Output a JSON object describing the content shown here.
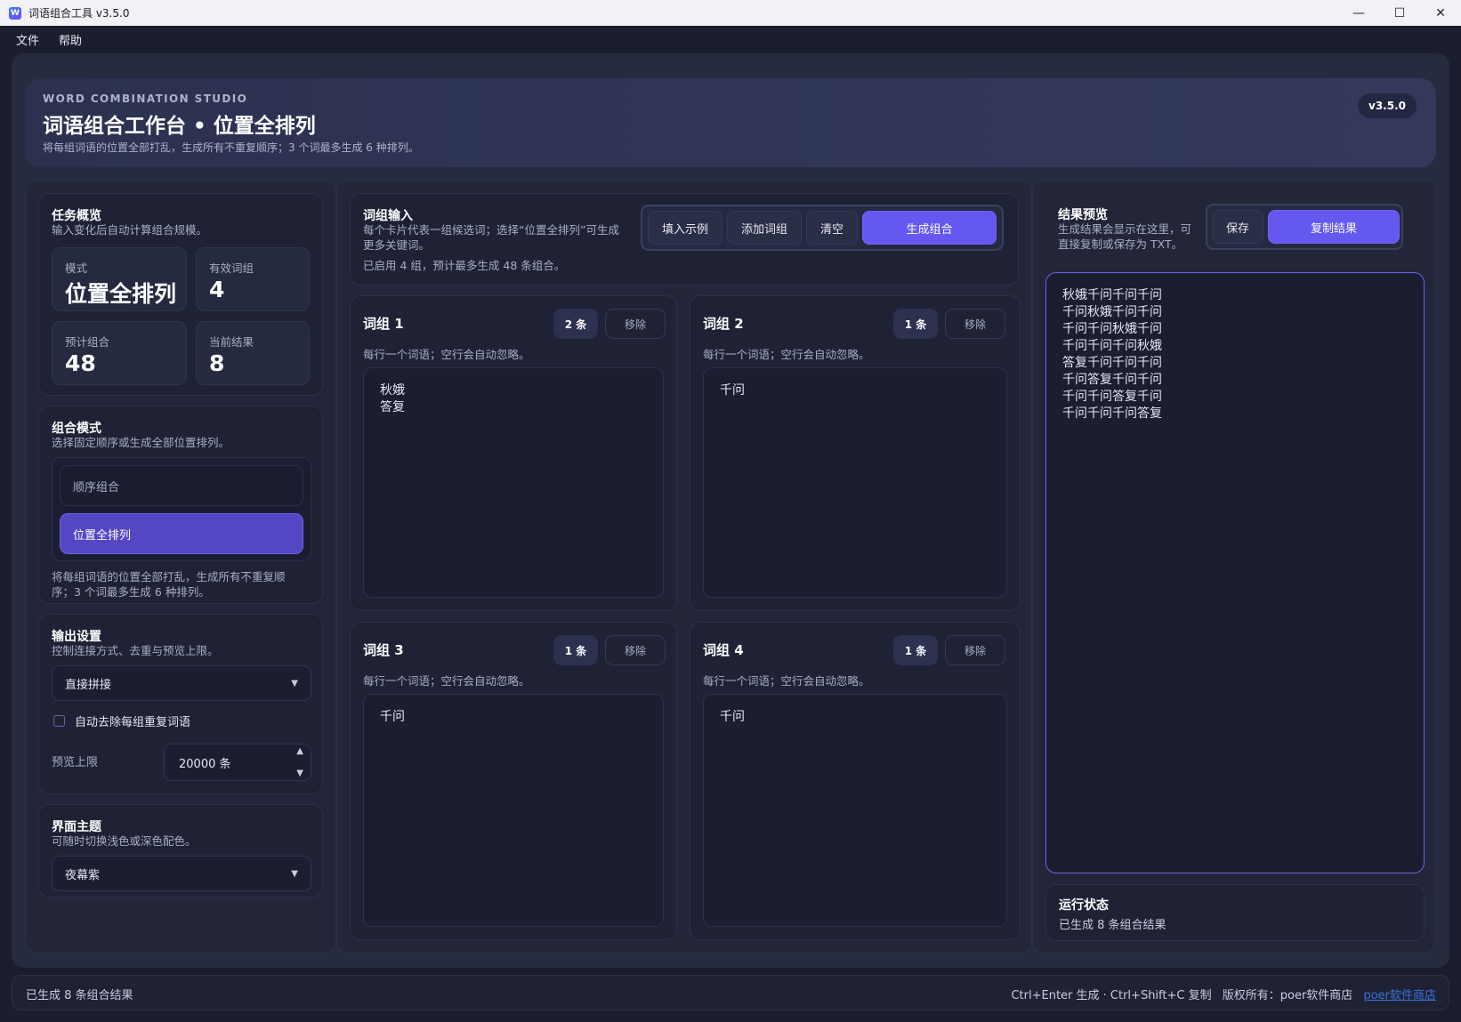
{
  "window": {
    "title": "词语组合工具 v3.5.0",
    "app_icon": "W",
    "controls": {
      "minimize": "—",
      "maximize": "☐",
      "close": "✕"
    }
  },
  "menu": [
    "文件",
    "帮助"
  ],
  "header": {
    "kicker": "WORD COMBINATION STUDIO",
    "title": "词语组合工作台 • 位置全排列",
    "subtitle": "将每组词语的位置全部打乱，生成所有不重复顺序；3 个词最多生成 6 种排列。",
    "version": "v3.5.0"
  },
  "overview": {
    "title": "任务概览",
    "subtitle": "输入变化后自动计算组合规模。",
    "stats": [
      {
        "label": "模式",
        "value": "位置全排列"
      },
      {
        "label": "有效词组",
        "value": "4"
      },
      {
        "label": "预计组合",
        "value": "48"
      },
      {
        "label": "当前结果",
        "value": "8"
      }
    ]
  },
  "mode": {
    "title": "组合模式",
    "subtitle": "选择固定顺序或生成全部位置排列。",
    "options": [
      "顺序组合",
      "位置全排列"
    ],
    "selected": "位置全排列",
    "description_lines": [
      "将每组词语的位置全部打乱，生成所有不重复顺",
      "序；3 个词最多生成 6 种排列。"
    ]
  },
  "output": {
    "title": "输出设置",
    "subtitle": "控制连接方式、去重与预览上限。",
    "join_mode": "直接拼接",
    "dedupe_label": "自动去除每组重复词语",
    "dedupe_checked": false,
    "preview_label": "预览上限",
    "preview_value": "20000 条"
  },
  "theme": {
    "title": "界面主题",
    "subtitle": "可随时切换浅色或深色配色。",
    "value": "夜幕紫"
  },
  "input": {
    "title": "词组输入",
    "subtitle_lines": [
      "每个卡片代表一组候选词；选择“位置全排列”可生成",
      "更多关键词。"
    ],
    "status": "已启用 4 组，预计最多生成 48 条组合。",
    "buttons": {
      "example": "填入示例",
      "add": "添加词组",
      "clear": "清空",
      "generate": "生成组合"
    }
  },
  "groups": [
    {
      "title": "词组 1",
      "count": "2 条",
      "remove": "移除",
      "hint": "每行一个词语；空行会自动忽略。",
      "text": "秋娥\n答复"
    },
    {
      "title": "词组 2",
      "count": "1 条",
      "remove": "移除",
      "hint": "每行一个词语；空行会自动忽略。",
      "text": "千问"
    },
    {
      "title": "词组 3",
      "count": "1 条",
      "remove": "移除",
      "hint": "每行一个词语；空行会自动忽略。",
      "text": "千问"
    },
    {
      "title": "词组 4",
      "count": "1 条",
      "remove": "移除",
      "hint": "每行一个词语；空行会自动忽略。",
      "text": "千问"
    }
  ],
  "results": {
    "title": "结果预览",
    "subtitle_lines": [
      "生成结果会显示在这里，可",
      "直接复制或保存为 TXT。"
    ],
    "buttons": {
      "save": "保存",
      "copy": "复制结果"
    },
    "text": "秋娥千问千问千问\n千问秋娥千问千问\n千问千问秋娥千问\n千问千问千问秋娥\n答复千问千问千问\n千问答复千问千问\n千问千问答复千问\n千问千问千问答复"
  },
  "run_status": {
    "title": "运行状态",
    "text": "已生成 8 条组合结果"
  },
  "statusbar": {
    "left": "已生成 8 条组合结果",
    "shortcuts": "Ctrl+Enter 生成 · Ctrl+Shift+C 复制",
    "copyright": "版权所有：poer软件商店",
    "link": "poer软件商店"
  },
  "colors": {
    "accent": "#6458f0",
    "background": "#1b1e2e",
    "link": "#3d6fd8"
  }
}
